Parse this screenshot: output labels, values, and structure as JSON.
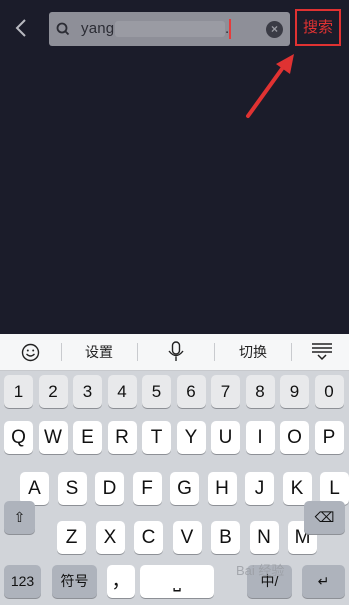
{
  "search": {
    "query_prefix": "yang",
    "query_suffix": ".",
    "button_label": "搜索"
  },
  "toolbar": {
    "settings": "设置",
    "switch": "切换"
  },
  "keys": {
    "row_num": [
      "1",
      "2",
      "3",
      "4",
      "5",
      "6",
      "7",
      "8",
      "9",
      "0"
    ],
    "row1": [
      "Q",
      "W",
      "E",
      "R",
      "T",
      "Y",
      "U",
      "I",
      "O",
      "P"
    ],
    "row2": [
      "A",
      "S",
      "D",
      "F",
      "G",
      "H",
      "J",
      "K",
      "L"
    ],
    "row3": [
      "Z",
      "X",
      "C",
      "V",
      "B",
      "N",
      "M"
    ],
    "numbers_mode": "123",
    "symbols": "符号",
    "comma": "，",
    "lang": "中/",
    "space": "⎵"
  },
  "watermark": "Bai 经验"
}
